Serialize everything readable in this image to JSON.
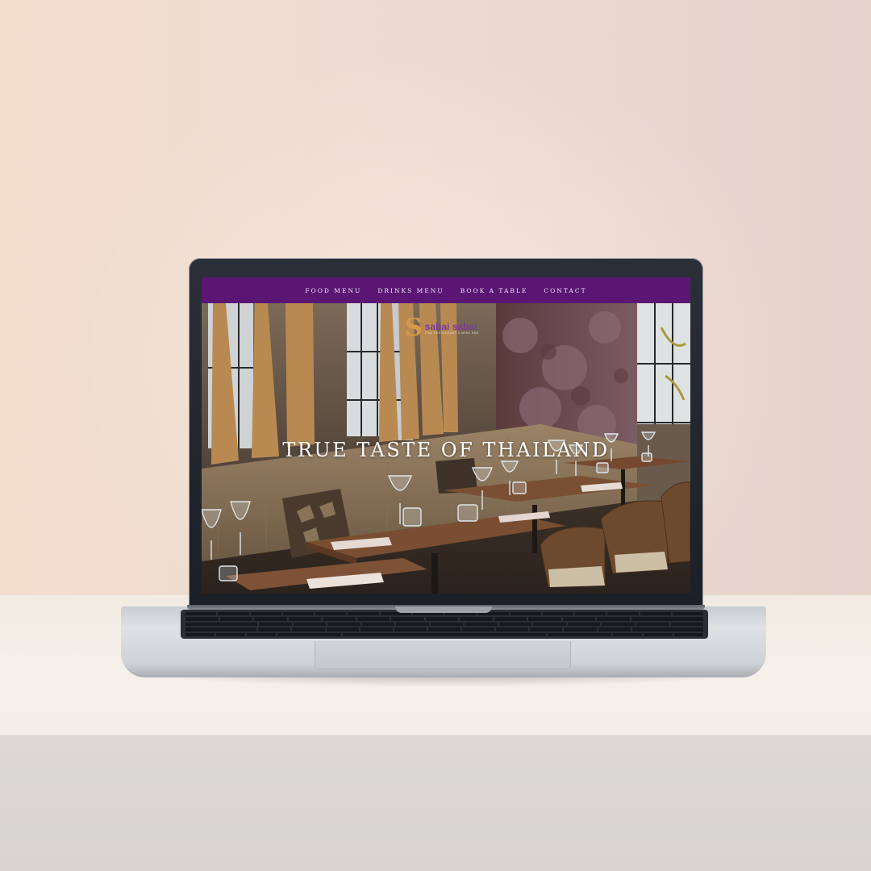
{
  "site": {
    "nav": {
      "items": [
        "FOOD MENU",
        "DRINKS MENU",
        "BOOK A TABLE",
        "CONTACT"
      ]
    },
    "logo": {
      "mark": "S",
      "name": "sabai sabai",
      "tagline": "THAI RESTAURANT & WINE BAR"
    },
    "hero": {
      "title": "TRUE TASTE OF THAILAND"
    }
  },
  "colors": {
    "nav_bar": "#5b1674",
    "logo_gold": "#d49a4a",
    "logo_purple": "#7a3b9c"
  }
}
